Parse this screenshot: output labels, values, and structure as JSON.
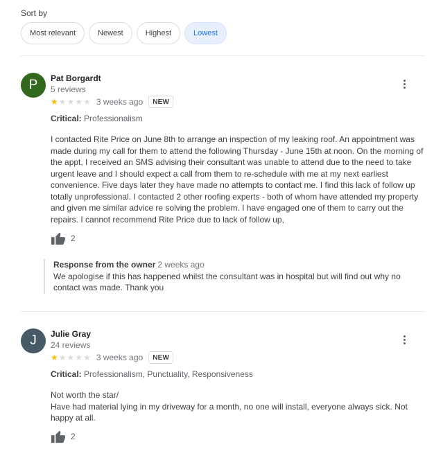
{
  "sort": {
    "label": "Sort by",
    "options": [
      "Most relevant",
      "Newest",
      "Highest",
      "Lowest"
    ],
    "selected": "Lowest"
  },
  "reviews": [
    {
      "initial": "P",
      "avatar_color": "#33691e",
      "name": "Pat Borgardt",
      "review_count": "5 reviews",
      "rating": 1,
      "rating_max": 5,
      "time": "3 weeks ago",
      "badge": "NEW",
      "critical_label": "Critical:",
      "critical_text": "Professionalism",
      "text_lines": [
        "I contacted Rite Price on June 8th to arrange an inspection of my leaking roof. An appointment was made during my call for them to attend the following Thursday  - June 15th at noon. On the morning of the appt, I received an SMS advising their consultant was unable to attend due to the need to take urgent leave and I should expect a call from them to re-schedule with me at my next earliest convenience. Five days later they have made no attempts to contact me. I find this lack of follow up totally unprofessional. I contacted 2 other roofing experts - both of whom have  attended my property and given me similar advice re solving the problem. I have engaged one of them to carry out the repairs. I cannot recommend Rite Price due to lack of follow up,"
      ],
      "likes": "2",
      "owner_response": {
        "label": "Response from the owner",
        "time": "2 weeks ago",
        "text": "We apologise if this has happened whilst the consultant was in hospital but will find out why no contact was made. Thank you"
      }
    },
    {
      "initial": "J",
      "avatar_color": "#455a64",
      "name": "Julie Gray",
      "review_count": "24 reviews",
      "rating": 1,
      "rating_max": 5,
      "time": "3 weeks ago",
      "badge": "NEW",
      "critical_label": "Critical:",
      "critical_text": "Professionalism, Punctuality, Responsiveness",
      "text_lines": [
        "Not worth the star/",
        "Have had material lying in my driveway for a month, no one will install, everyone always sick. Not happy at all."
      ],
      "likes": "2"
    }
  ],
  "icons": {
    "like": "thumb-up-icon",
    "more": "more-vert-icon"
  }
}
